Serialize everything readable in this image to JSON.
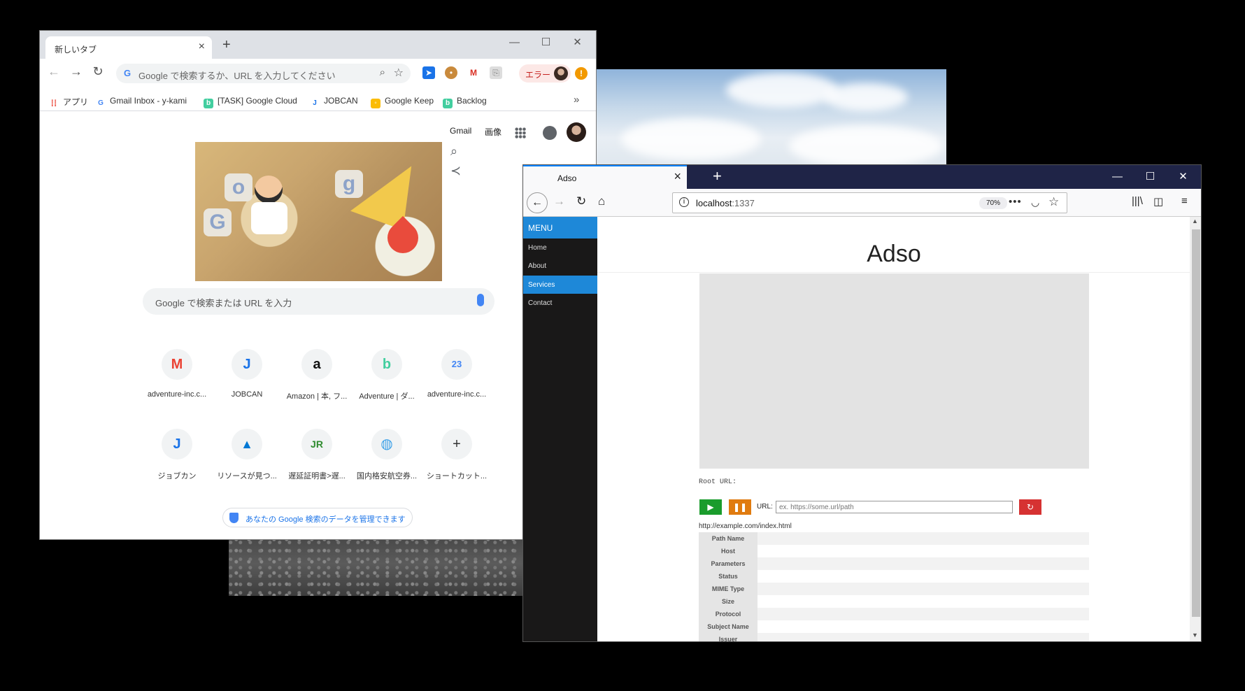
{
  "chrome": {
    "tab_title": "新しいタブ",
    "new_tab": "+",
    "omnibox_placeholder": "Google で検索するか、URL を入力してください",
    "error_label": "エラー",
    "bookmarks": [
      {
        "label": "アプリ",
        "icon": "apps-icon",
        "color": "#ea4335"
      },
      {
        "label": "Gmail Inbox - y-kami",
        "icon": "google-icon",
        "color": "#4285f4"
      },
      {
        "label": "[TASK] Google Cloud",
        "icon": "backlog-icon",
        "color": "#42ce9f"
      },
      {
        "label": "JOBCAN",
        "icon": "jobcan-icon",
        "color": "#1a73e8"
      },
      {
        "label": "Google Keep",
        "icon": "keep-icon",
        "color": "#fbbc04"
      },
      {
        "label": "Backlog",
        "icon": "backlog-icon",
        "color": "#42ce9f"
      }
    ],
    "top_links": {
      "gmail": "Gmail",
      "images": "画像"
    },
    "search_placeholder": "Google で検索または URL を入力",
    "shortcuts_row1": [
      {
        "label": "adventure-inc.c...",
        "icon": "gmail-icon",
        "glyph": "M",
        "color": "#ea4335"
      },
      {
        "label": "JOBCAN",
        "icon": "jobcan-icon",
        "glyph": "J",
        "color": "#1a73e8"
      },
      {
        "label": "Amazon | 本, フ...",
        "icon": "amazon-icon",
        "glyph": "a",
        "color": "#111111"
      },
      {
        "label": "Adventure | ダ...",
        "icon": "backlog-icon",
        "glyph": "b",
        "color": "#42ce9f"
      },
      {
        "label": "adventure-inc.c...",
        "icon": "calendar-icon",
        "glyph": "23",
        "color": "#4285f4"
      }
    ],
    "shortcuts_row2": [
      {
        "label": "ジョブカン",
        "icon": "jobcan-icon",
        "glyph": "J",
        "color": "#1a73e8"
      },
      {
        "label": "リソースが見つ...",
        "icon": "azure-icon",
        "glyph": "▲",
        "color": "#0078d4"
      },
      {
        "label": "遅延証明書>遅...",
        "icon": "jr-icon",
        "glyph": "JR",
        "color": "#2e8b2e"
      },
      {
        "label": "国内格安航空券...",
        "icon": "globe-icon",
        "glyph": "◍",
        "color": "#3aa0e8"
      },
      {
        "label": "ショートカット...",
        "icon": "add-icon",
        "glyph": "+",
        "color": "#333333"
      }
    ],
    "privacy_text": "あなたの Google 検索のデータを管理できます"
  },
  "firefox": {
    "tab_title": "Adso",
    "url_host": "localhost",
    "url_port": ":1337",
    "zoom": "70%",
    "menu_label": "MENU",
    "menu_items": [
      {
        "label": "Home",
        "active": false
      },
      {
        "label": "About",
        "active": false
      },
      {
        "label": "Services",
        "active": true
      },
      {
        "label": "Contact",
        "active": false
      }
    ],
    "page_title": "Adso",
    "root_url_label": "Root URL:",
    "url_label": "URL:",
    "url_placeholder": "ex. https://some.url/path",
    "current_url": "http://example.com/index.html",
    "info_rows": [
      {
        "label": "Path Name",
        "value": ""
      },
      {
        "label": "Host",
        "value": ""
      },
      {
        "label": "Parameters",
        "value": ""
      },
      {
        "label": "Status",
        "value": ""
      },
      {
        "label": "MIME Type",
        "value": ""
      },
      {
        "label": "Size",
        "value": ""
      },
      {
        "label": "Protocol",
        "value": ""
      },
      {
        "label": "Subject Name",
        "value": ""
      },
      {
        "label": "Issuer",
        "value": ""
      }
    ],
    "colors": {
      "accent": "#1e88d8",
      "play": "#1a9c2c",
      "pause": "#e07b10",
      "reload": "#d63232",
      "titlebar": "#1f2447"
    }
  }
}
